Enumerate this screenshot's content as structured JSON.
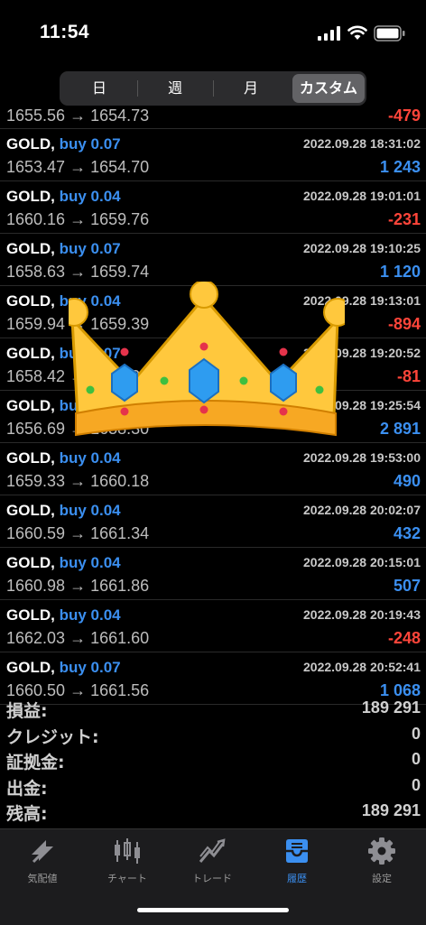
{
  "status": {
    "time": "11:54"
  },
  "periods": {
    "day": "日",
    "week": "週",
    "month": "月",
    "custom": "カスタム"
  },
  "trades": [
    {
      "symbol": "",
      "side": "",
      "date": "",
      "prices": "1655.56 → 1654.73",
      "profit": "-479",
      "sign": "neg"
    },
    {
      "symbol": "GOLD,",
      "side": "buy 0.07",
      "date": "2022.09.28 18:31:02",
      "prices": "1653.47 → 1654.70",
      "profit": "1 243",
      "sign": "pos"
    },
    {
      "symbol": "GOLD,",
      "side": "buy 0.04",
      "date": "2022.09.28 19:01:01",
      "prices": "1660.16 → 1659.76",
      "profit": "-231",
      "sign": "neg"
    },
    {
      "symbol": "GOLD,",
      "side": "buy 0.07",
      "date": "2022.09.28 19:10:25",
      "prices": "1658.63 → 1659.74",
      "profit": "1 120",
      "sign": "pos"
    },
    {
      "symbol": "GOLD,",
      "side": "buy 0.04",
      "date": "2022.09.28 19:13:01",
      "prices": "1659.94 → 1659.39",
      "profit": "-894",
      "sign": "neg"
    },
    {
      "symbol": "GOLD,",
      "side": "buy 0.07",
      "date": "2022.09.28 19:20:52",
      "prices": "1658.42 → 1658.38",
      "profit": "-81",
      "sign": "neg"
    },
    {
      "symbol": "GOLD,",
      "side": "buy 0.07",
      "date": "2022.09.28 19:25:54",
      "prices": "1656.69 → 1658.30",
      "profit": "2 891",
      "sign": "pos"
    },
    {
      "symbol": "GOLD,",
      "side": "buy 0.04",
      "date": "2022.09.28 19:53:00",
      "prices": "1659.33 → 1660.18",
      "profit": "490",
      "sign": "pos"
    },
    {
      "symbol": "GOLD,",
      "side": "buy 0.04",
      "date": "2022.09.28 20:02:07",
      "prices": "1660.59 → 1661.34",
      "profit": "432",
      "sign": "pos"
    },
    {
      "symbol": "GOLD,",
      "side": "buy 0.04",
      "date": "2022.09.28 20:15:01",
      "prices": "1660.98 → 1661.86",
      "profit": "507",
      "sign": "pos"
    },
    {
      "symbol": "GOLD,",
      "side": "buy 0.04",
      "date": "2022.09.28 20:19:43",
      "prices": "1662.03 → 1661.60",
      "profit": "-248",
      "sign": "neg"
    },
    {
      "symbol": "GOLD,",
      "side": "buy 0.07",
      "date": "2022.09.28 20:52:41",
      "prices": "1660.50 → 1661.56",
      "profit": "1 068",
      "sign": "pos"
    }
  ],
  "summary": [
    {
      "label": "損益:",
      "value": "189 291"
    },
    {
      "label": "クレジット:",
      "value": "0"
    },
    {
      "label": "証拠金:",
      "value": "0"
    },
    {
      "label": "出金:",
      "value": "0"
    },
    {
      "label": "残高:",
      "value": "189 291"
    }
  ],
  "tabs": [
    {
      "label": "気配値",
      "icon": "quotes-icon"
    },
    {
      "label": "チャート",
      "icon": "chart-icon"
    },
    {
      "label": "トレード",
      "icon": "trade-icon"
    },
    {
      "label": "履歴",
      "icon": "history-icon",
      "active": true
    },
    {
      "label": "設定",
      "icon": "settings-icon"
    }
  ],
  "overlay": {
    "icon": "crown-emoji"
  },
  "colors": {
    "profit_positive": "#3b8ff0",
    "profit_negative": "#ff453a",
    "active_tab": "#3b8ff0"
  }
}
